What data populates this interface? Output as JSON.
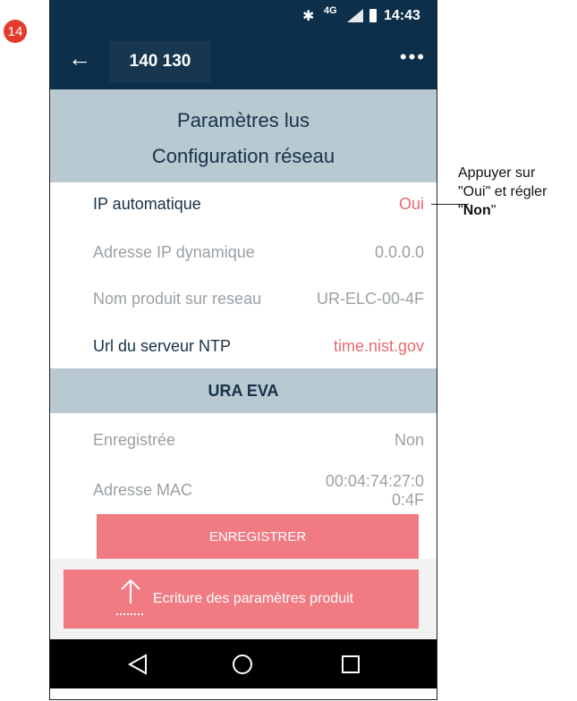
{
  "badge": "14",
  "status_bar": {
    "network": "4G",
    "time": "14:43"
  },
  "app_bar": {
    "title": "140 130"
  },
  "section_main": {
    "line1": "Paramètres lus",
    "line2": "Configuration réseau"
  },
  "rows": [
    {
      "label": "IP automatique",
      "value": "Oui"
    },
    {
      "label": "Adresse IP dynamique",
      "value": "0.0.0.0"
    },
    {
      "label": "Nom produit sur reseau",
      "value": "UR-ELC-00-4F"
    },
    {
      "label": "Url du serveur NTP",
      "value": "time.nist.gov"
    }
  ],
  "section_ura": {
    "title": "URA EVA"
  },
  "ura_rows": [
    {
      "label": "Enregistrée",
      "value": "Non"
    },
    {
      "label": "Adresse MAC",
      "value_line1": "00:04:74:27:0",
      "value_line2": "0:4F"
    }
  ],
  "buttons": {
    "save": "ENREGISTRER",
    "write": "Ecriture des paramètres produit"
  },
  "callout": {
    "line1": "Appuyer sur",
    "line2_part1": "\"Oui\" et régler",
    "line3_prefix": "\"",
    "line3_bold": "Non",
    "line3_suffix": "\""
  },
  "colors": {
    "app_bar": "#0d2f4a",
    "section_header": "#b8c9d2",
    "accent_red": "#e86a6e",
    "button_red": "#f07b82",
    "badge_red": "#e63a2e"
  },
  "icons": {
    "back": "arrow-left",
    "more": "three-dots",
    "upload": "arrow-up",
    "bluetooth": "bluetooth",
    "signal": "signal",
    "battery": "battery"
  }
}
